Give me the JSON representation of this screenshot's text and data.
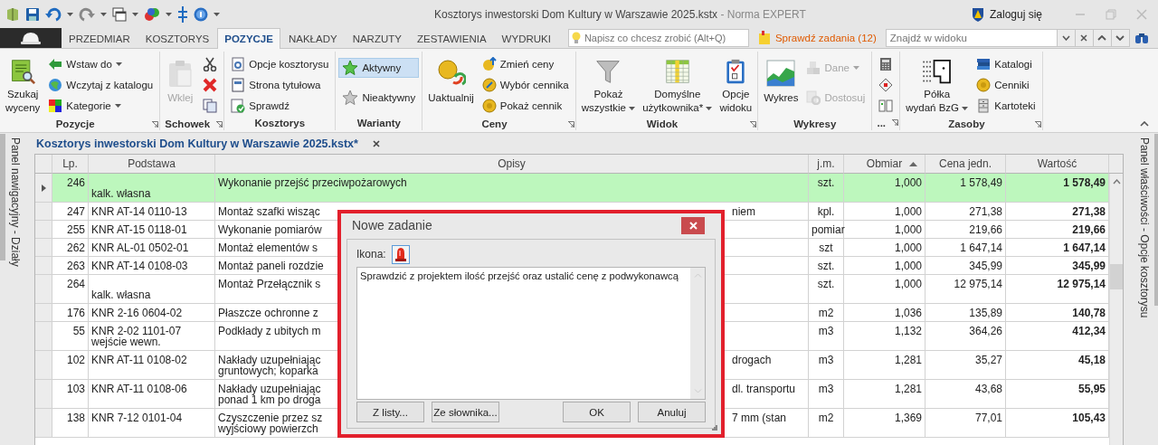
{
  "title_bar": {
    "document": "Kosztorys inwestorski Dom Kultury w Warszawie 2025.kstx",
    "app": "- Norma EXPERT",
    "login": "Zaloguj się"
  },
  "ribbon_tabs": [
    {
      "label": "PRZEDMIAR",
      "selected": false
    },
    {
      "label": "KOSZTORYS",
      "selected": false
    },
    {
      "label": "POZYCJE",
      "selected": true
    },
    {
      "label": "NAKŁADY",
      "selected": false
    },
    {
      "label": "NARZUTY",
      "selected": false
    },
    {
      "label": "ZESTAWIENIA",
      "selected": false
    },
    {
      "label": "WYDRUKI",
      "selected": false
    }
  ],
  "tell_me": {
    "placeholder": "Napisz co chcesz zrobić (Alt+Q)"
  },
  "tasks_button": {
    "label": "Sprawdź zadania (12)"
  },
  "find": {
    "placeholder": "Znajdź w widoku"
  },
  "ribbon": {
    "groups": [
      {
        "label": "Pozycje",
        "launcher": true,
        "items": [
          {
            "kind": "large",
            "label": "Szukaj\nwyceny",
            "dropdown": false,
            "disabled": false
          },
          {
            "kind": "small",
            "label": "Wstaw do",
            "dropdown": true,
            "disabled": false
          },
          {
            "kind": "small",
            "label": "Wczytaj z katalogu",
            "dropdown": false,
            "disabled": false
          },
          {
            "kind": "small",
            "label": "Kategorie",
            "dropdown": true,
            "disabled": false
          }
        ]
      },
      {
        "label": "Schowek",
        "launcher": true,
        "items": [
          {
            "kind": "large",
            "label": "Wklej",
            "dropdown": false,
            "disabled": true
          },
          {
            "kind": "icon",
            "dropdown": false,
            "disabled": false
          },
          {
            "kind": "icon",
            "dropdown": false,
            "disabled": false
          },
          {
            "kind": "icon",
            "dropdown": false,
            "disabled": false
          }
        ]
      },
      {
        "label": "Kosztorys",
        "launcher": false,
        "items": [
          {
            "kind": "small",
            "label": "Opcje kosztorysu",
            "dropdown": false,
            "disabled": false
          },
          {
            "kind": "small",
            "label": "Strona tytułowa",
            "dropdown": false,
            "disabled": false
          },
          {
            "kind": "small",
            "label": "Sprawdź",
            "dropdown": false,
            "disabled": false
          }
        ]
      },
      {
        "label": "Warianty",
        "launcher": false,
        "items": [
          {
            "kind": "small",
            "label": "Aktywny",
            "dropdown": false,
            "disabled": false,
            "selected": true
          },
          {
            "kind": "small",
            "label": "Nieaktywny",
            "dropdown": false,
            "disabled": false,
            "selected": false
          }
        ]
      },
      {
        "label": "Ceny",
        "launcher": true,
        "items": [
          {
            "kind": "large",
            "label": "Uaktualnij",
            "dropdown": false,
            "disabled": false
          },
          {
            "kind": "small",
            "label": "Zmień ceny",
            "dropdown": false,
            "disabled": false
          },
          {
            "kind": "small",
            "label": "Wybór cennika",
            "dropdown": false,
            "disabled": false
          },
          {
            "kind": "small",
            "label": "Pokaż cennik",
            "dropdown": false,
            "disabled": false
          }
        ]
      },
      {
        "label": "Widok",
        "launcher": true,
        "items": [
          {
            "kind": "large",
            "label": "Pokaż\nwszystkie",
            "dropdown": true,
            "disabled": false
          },
          {
            "kind": "large",
            "label": "Domyślne\nużytkownika*",
            "dropdown": true,
            "disabled": false
          },
          {
            "kind": "large",
            "label": "Opcje\nwidoku",
            "dropdown": false,
            "disabled": false
          }
        ]
      },
      {
        "label": "Wykresy",
        "launcher": false,
        "items": [
          {
            "kind": "large",
            "label": "Wykres",
            "dropdown": false,
            "disabled": false
          },
          {
            "kind": "small",
            "label": "Dane",
            "dropdown": true,
            "disabled": true
          },
          {
            "kind": "small",
            "label": "Dostosuj",
            "dropdown": false,
            "disabled": true
          }
        ]
      },
      {
        "label": "...",
        "launcher": true,
        "items": [
          {
            "kind": "icon",
            "dropdown": false,
            "disabled": false
          },
          {
            "kind": "icon",
            "dropdown": false,
            "disabled": false
          },
          {
            "kind": "icon",
            "dropdown": false,
            "disabled": false
          }
        ]
      },
      {
        "label": "Zasoby",
        "launcher": true,
        "items": [
          {
            "kind": "large",
            "label": "Półka\nwydań BzG",
            "dropdown": true,
            "disabled": false
          },
          {
            "kind": "small",
            "label": "Katalogi",
            "dropdown": false,
            "disabled": false
          },
          {
            "kind": "small",
            "label": "Cenniki",
            "dropdown": false,
            "disabled": false
          },
          {
            "kind": "small",
            "label": "Kartoteki",
            "dropdown": false,
            "disabled": false
          }
        ]
      }
    ]
  },
  "navigation_panel": {
    "label": "Panel nawigacyjny - Działy"
  },
  "properties_panel": {
    "label": "Panel właściwości - Opcje kosztorysu"
  },
  "document_tab": {
    "label": "Kosztorys inwestorski Dom Kultury w Warszawie 2025.kstx*"
  },
  "table": {
    "columns": [
      {
        "label": "Lp.",
        "sorted": false
      },
      {
        "label": "Podstawa",
        "sorted": false
      },
      {
        "label": "Opisy",
        "sorted": false
      },
      {
        "label": "j.m.",
        "sorted": false
      },
      {
        "label": "Obmiar",
        "sorted": true
      },
      {
        "label": "Cena jedn.",
        "sorted": false
      },
      {
        "label": "Wartość",
        "sorted": false
      }
    ],
    "rows": [
      {
        "lp": "246",
        "kind": "own",
        "podstawa": "kalk. własna",
        "opis": "Wykonanie przejść przeciwpożarowych",
        "jm": "szt.",
        "obmiar": "1,000",
        "cena": "1 578,49",
        "wartosc": "1 578,49",
        "selected": true
      },
      {
        "lp": "247",
        "kind": "norm",
        "podstawa": "KNR AT-14 0110-13",
        "opis": "Montaż szafki wisząc",
        "opis_right": "niem",
        "jm": "kpl.",
        "obmiar": "1,000",
        "cena": "271,38",
        "wartosc": "271,38",
        "selected": false
      },
      {
        "lp": "255",
        "kind": "norm",
        "podstawa": "KNR AT-15 0118-01",
        "opis": "Wykonanie pomiarów",
        "jm": "pomiar",
        "obmiar": "1,000",
        "cena": "219,66",
        "wartosc": "219,66",
        "selected": false
      },
      {
        "lp": "262",
        "kind": "norm",
        "podstawa": "KNR AL-01 0502-01",
        "opis": "Montaż elementów s",
        "jm": "szt",
        "obmiar": "1,000",
        "cena": "1 647,14",
        "wartosc": "1 647,14",
        "selected": false
      },
      {
        "lp": "263",
        "kind": "norm",
        "podstawa": "KNR AT-14 0108-03",
        "opis": "Montaż paneli rozdzie",
        "jm": "szt.",
        "obmiar": "1,000",
        "cena": "345,99",
        "wartosc": "345,99",
        "selected": false
      },
      {
        "lp": "264",
        "kind": "own",
        "podstawa": "kalk. własna",
        "opis": "Montaż Przełącznik s",
        "jm": "szt.",
        "obmiar": "1,000",
        "cena": "12 975,14",
        "wartosc": "12 975,14",
        "selected": false
      },
      {
        "lp": "176",
        "kind": "norm",
        "podstawa": "KNR 2-16 0604-02",
        "opis": "Płaszcze ochronne z",
        "jm": "m2",
        "obmiar": "1,036",
        "cena": "135,89",
        "wartosc": "140,78",
        "selected": false
      },
      {
        "lp": "55",
        "kind": "norm",
        "podstawa": "KNR 2-02 1101-07 wejście wewn.",
        "opis": "Podkłady z ubitych m",
        "jm": "m3",
        "obmiar": "1,132",
        "cena": "364,26",
        "wartosc": "412,34",
        "selected": false
      },
      {
        "lp": "102",
        "kind": "norm",
        "podstawa": "KNR AT-11 0108-02",
        "opis": "Nakłady uzupełniając\ngruntowych; koparka",
        "opis_right": "drogach",
        "jm": "m3",
        "obmiar": "1,281",
        "cena": "35,27",
        "wartosc": "45,18",
        "selected": false
      },
      {
        "lp": "103",
        "kind": "norm",
        "podstawa": "KNR AT-11 0108-06",
        "opis": "Nakłady uzupełniając\nponad 1 km po droga",
        "opis_right": "dl. transportu",
        "jm": "m3",
        "obmiar": "1,281",
        "cena": "43,68",
        "wartosc": "55,95",
        "selected": false
      },
      {
        "lp": "138",
        "kind": "norm",
        "podstawa": "KNR 7-12 0101-04",
        "opis": "Czyszczenie przez sz\nwyjściowy powierzch",
        "opis_right": "7 mm (stan",
        "jm": "m2",
        "obmiar": "1,369",
        "cena": "77,01",
        "wartosc": "105,43",
        "selected": false
      }
    ]
  },
  "dialog": {
    "title": "Nowe zadanie",
    "icon_label": "Ikona:",
    "text": "Sprawdzić z projektem ilość przejść oraz ustalić cenę z podwykonawcą",
    "buttons": [
      "Z listy...",
      "Ze słownika...",
      "OK",
      "Anuluj"
    ]
  }
}
